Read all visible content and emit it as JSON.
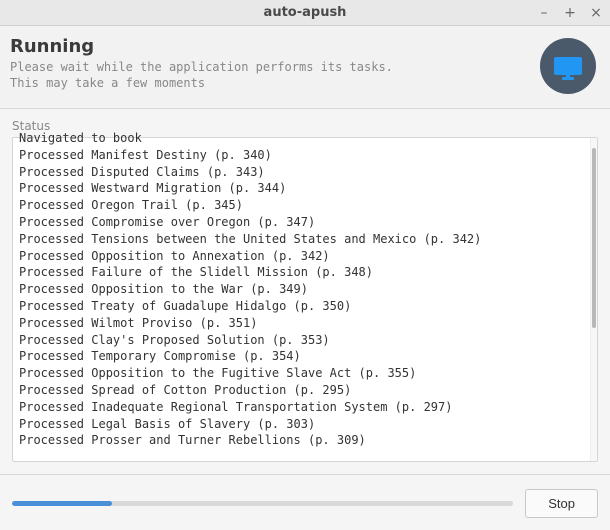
{
  "window": {
    "title": "auto-apush"
  },
  "header": {
    "title": "Running",
    "subtitle": "Please wait while the application performs its tasks.\nThis may take a few moments"
  },
  "status": {
    "label": "Status",
    "cutoff_line": "Navigated to book",
    "lines": [
      "Processed Manifest Destiny (p. 340)",
      "Processed Disputed Claims (p. 343)",
      "Processed Westward Migration (p. 344)",
      "Processed Oregon Trail (p. 345)",
      "Processed Compromise over Oregon (p. 347)",
      "Processed Tensions between the United States and Mexico (p. 342)",
      "Processed Opposition to Annexation (p. 342)",
      "Processed Failure of the Slidell Mission (p. 348)",
      "Processed Opposition to the War (p. 349)",
      "Processed Treaty of Guadalupe Hidalgo (p. 350)",
      "Processed Wilmot Proviso (p. 351)",
      "Processed Clay's Proposed Solution (p. 353)",
      "Processed Temporary Compromise (p. 354)",
      "Processed Opposition to the Fugitive Slave Act (p. 355)",
      "Processed Spread of Cotton Production (p. 295)",
      "Processed Inadequate Regional Transportation System (p. 297)",
      "Processed Legal Basis of Slavery (p. 303)",
      "Processed Prosser and Turner Rebellions (p. 309)"
    ]
  },
  "progress": {
    "percent": 20
  },
  "buttons": {
    "stop": "Stop"
  }
}
